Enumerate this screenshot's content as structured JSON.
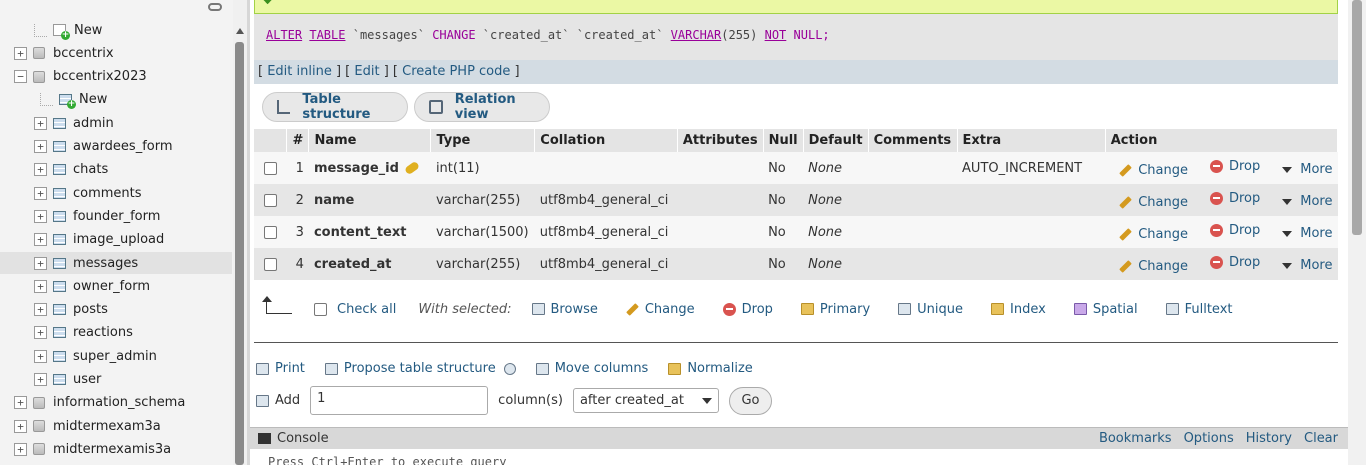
{
  "sidebar": {
    "items": [
      {
        "label": "New",
        "level": 1,
        "kind": "new"
      },
      {
        "label": "bccentrix",
        "level": 0,
        "kind": "db",
        "expander": "+"
      },
      {
        "label": "bccentrix2023",
        "level": 0,
        "kind": "db",
        "expander": "−"
      },
      {
        "label": "New",
        "level": 2,
        "kind": "new-table"
      },
      {
        "label": "admin",
        "level": 1,
        "kind": "table",
        "expander": "+"
      },
      {
        "label": "awardees_form",
        "level": 1,
        "kind": "table",
        "expander": "+"
      },
      {
        "label": "chats",
        "level": 1,
        "kind": "table",
        "expander": "+"
      },
      {
        "label": "comments",
        "level": 1,
        "kind": "table",
        "expander": "+"
      },
      {
        "label": "founder_form",
        "level": 1,
        "kind": "table",
        "expander": "+"
      },
      {
        "label": "image_upload",
        "level": 1,
        "kind": "table",
        "expander": "+"
      },
      {
        "label": "messages",
        "level": 1,
        "kind": "table",
        "expander": "+",
        "active": true
      },
      {
        "label": "owner_form",
        "level": 1,
        "kind": "table",
        "expander": "+"
      },
      {
        "label": "posts",
        "level": 1,
        "kind": "table",
        "expander": "+"
      },
      {
        "label": "reactions",
        "level": 1,
        "kind": "table",
        "expander": "+"
      },
      {
        "label": "super_admin",
        "level": 1,
        "kind": "table",
        "expander": "+"
      },
      {
        "label": "user",
        "level": 1,
        "kind": "table",
        "expander": "+"
      },
      {
        "label": "information_schema",
        "level": 0,
        "kind": "db",
        "expander": "+"
      },
      {
        "label": "midtermexam3a",
        "level": 0,
        "kind": "db",
        "expander": "+"
      },
      {
        "label": "midtermexamis3a",
        "level": 0,
        "kind": "db",
        "expander": "+"
      }
    ]
  },
  "sql": {
    "kw_alter": "ALTER",
    "kw_table": "TABLE",
    "table_name": "`messages`",
    "kw_change": "CHANGE",
    "col_old": "`created_at`",
    "col_new": "`created_at`",
    "type": "VARCHAR",
    "type_len": "(255)",
    "kw_not": "NOT",
    "kw_null": "NULL;"
  },
  "sql_links": {
    "edit_inline": "Edit inline",
    "edit": "Edit",
    "create_php": "Create PHP code"
  },
  "tabs": {
    "structure": "Table structure",
    "relation": "Relation view"
  },
  "table": {
    "headers": [
      "#",
      "Name",
      "Type",
      "Collation",
      "Attributes",
      "Null",
      "Default",
      "Comments",
      "Extra",
      "Action"
    ],
    "rows": [
      {
        "num": "1",
        "name": "message_id",
        "type": "int(11)",
        "collation": "",
        "attributes": "",
        "null": "No",
        "default": "None",
        "comments": "",
        "extra": "AUTO_INCREMENT",
        "primary": true
      },
      {
        "num": "2",
        "name": "name",
        "type": "varchar(255)",
        "collation": "utf8mb4_general_ci",
        "attributes": "",
        "null": "No",
        "default": "None",
        "comments": "",
        "extra": ""
      },
      {
        "num": "3",
        "name": "content_text",
        "type": "varchar(1500)",
        "collation": "utf8mb4_general_ci",
        "attributes": "",
        "null": "No",
        "default": "None",
        "comments": "",
        "extra": ""
      },
      {
        "num": "4",
        "name": "created_at",
        "type": "varchar(255)",
        "collation": "utf8mb4_general_ci",
        "attributes": "",
        "null": "No",
        "default": "None",
        "comments": "",
        "extra": ""
      }
    ],
    "actions": {
      "change": "Change",
      "drop": "Drop",
      "more": "More"
    }
  },
  "with_selected": {
    "check_all": "Check all",
    "label": "With selected:",
    "items": [
      "Browse",
      "Change",
      "Drop",
      "Primary",
      "Unique",
      "Index",
      "Spatial",
      "Fulltext"
    ]
  },
  "tools": {
    "print": "Print",
    "propose": "Propose table structure",
    "move": "Move columns",
    "normalize": "Normalize"
  },
  "add": {
    "label": "Add",
    "value": "1",
    "columns_label": "column(s)",
    "position": "after created_at",
    "go": "Go"
  },
  "console": {
    "title": "Console",
    "links": [
      "Bookmarks",
      "Options",
      "History",
      "Clear"
    ],
    "hint": "Press Ctrl+Enter to execute query"
  }
}
